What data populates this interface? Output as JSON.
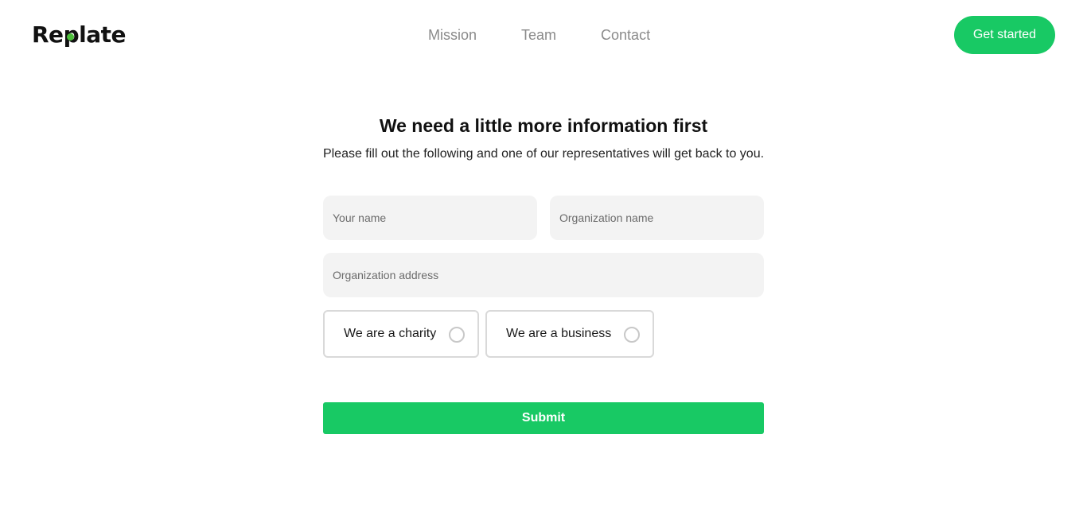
{
  "brand": {
    "logo_before": "Re",
    "logo_p": "p",
    "logo_after": "late",
    "accent_color": "#18c964",
    "logo_dot_color": "#4cbf3a"
  },
  "nav": {
    "items": [
      {
        "label": "Mission"
      },
      {
        "label": "Team"
      },
      {
        "label": "Contact"
      }
    ],
    "cta_label": "Get started"
  },
  "form": {
    "title": "We need a little more information first",
    "subtitle": "Please fill out the following and one of our representatives will get back to you.",
    "fields": {
      "name": {
        "placeholder": "Your name",
        "value": ""
      },
      "organization": {
        "placeholder": "Organization name",
        "value": ""
      },
      "address": {
        "placeholder": "Organization address",
        "value": ""
      }
    },
    "options": [
      {
        "label": "We are a charity",
        "selected": false
      },
      {
        "label": "We are a business",
        "selected": false
      }
    ],
    "submit_label": "Submit"
  }
}
